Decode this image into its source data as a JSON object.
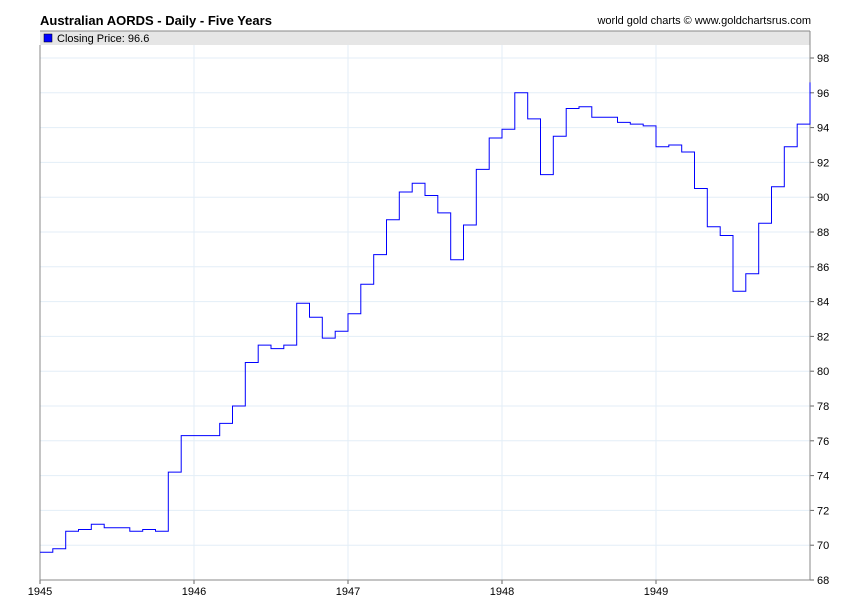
{
  "chart_data": {
    "type": "line",
    "title": "Australian AORDS - Daily - Five Years",
    "credit": "world gold charts © www.goldchartsrus.com",
    "legend": {
      "label": "Closing Price: 96.6",
      "placement": "top-left",
      "color": "#0000ff"
    },
    "xlabel": "",
    "ylabel": "",
    "x_ticks": [
      "1945",
      "1946",
      "1947",
      "1948",
      "1949"
    ],
    "xlim": [
      1945,
      1950
    ],
    "ylim": [
      68,
      99
    ],
    "y_ticks": [
      68,
      70,
      72,
      74,
      76,
      78,
      80,
      82,
      84,
      86,
      88,
      90,
      92,
      94,
      96,
      98
    ],
    "grid": true,
    "step": "monthly",
    "series": [
      {
        "name": "Closing Price",
        "color": "#0000ff",
        "start_year": 1945,
        "values": [
          69.6,
          69.8,
          70.8,
          70.9,
          71.2,
          71.0,
          71.0,
          70.8,
          70.9,
          70.8,
          74.2,
          76.3,
          76.3,
          76.3,
          77.0,
          78.0,
          80.5,
          81.5,
          81.3,
          81.5,
          83.9,
          83.1,
          81.9,
          82.3,
          83.3,
          85.0,
          86.7,
          88.7,
          90.3,
          90.8,
          90.1,
          89.1,
          86.4,
          88.4,
          91.6,
          93.4,
          93.9,
          96.0,
          94.5,
          91.3,
          93.5,
          95.1,
          95.2,
          94.6,
          94.6,
          94.3,
          94.2,
          94.1,
          92.9,
          93.0,
          92.6,
          90.5,
          88.3,
          87.8,
          84.6,
          85.6,
          88.5,
          90.6,
          92.9,
          94.2
        ],
        "last": 96.6
      }
    ]
  }
}
